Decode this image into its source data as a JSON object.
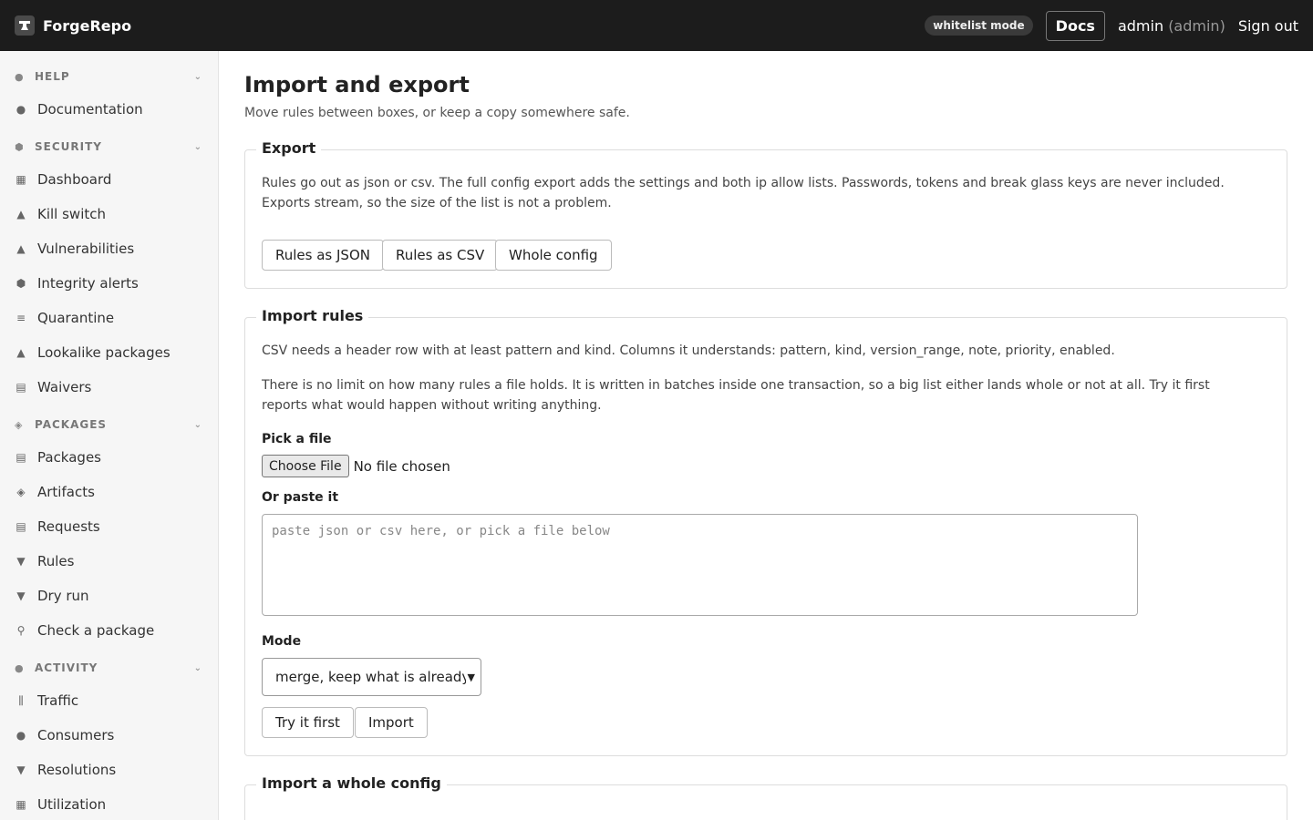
{
  "app": {
    "name": "ForgeRepo"
  },
  "header": {
    "mode_badge": "whitelist mode",
    "docs_label": "Docs",
    "user_name": "admin",
    "user_role": "(admin)",
    "sign_out_label": "Sign out"
  },
  "sidebar": {
    "sections": [
      {
        "label": "HELP",
        "icon": "info-icon"
      },
      {
        "label": "SECURITY",
        "icon": "shield-icon"
      },
      {
        "label": "PACKAGES",
        "icon": "box-icon"
      },
      {
        "label": "ACTIVITY",
        "icon": "info-icon"
      }
    ],
    "items": [
      {
        "label": "Documentation",
        "icon": "info-icon"
      },
      {
        "label": "Dashboard",
        "icon": "grid-icon"
      },
      {
        "label": "Kill switch",
        "icon": "warning-icon"
      },
      {
        "label": "Vulnerabilities",
        "icon": "warning-icon"
      },
      {
        "label": "Integrity alerts",
        "icon": "shield-icon"
      },
      {
        "label": "Quarantine",
        "icon": "list-icon"
      },
      {
        "label": "Lookalike packages",
        "icon": "warning-icon"
      },
      {
        "label": "Waivers",
        "icon": "note-icon"
      },
      {
        "label": "Packages",
        "icon": "archive-icon"
      },
      {
        "label": "Artifacts",
        "icon": "box-icon"
      },
      {
        "label": "Requests",
        "icon": "note-icon"
      },
      {
        "label": "Rules",
        "icon": "filter-icon"
      },
      {
        "label": "Dry run",
        "icon": "filter-icon"
      },
      {
        "label": "Check a package",
        "icon": "search-icon"
      },
      {
        "label": "Traffic",
        "icon": "bars-icon"
      },
      {
        "label": "Consumers",
        "icon": "user-icon"
      },
      {
        "label": "Resolutions",
        "icon": "filter-icon"
      },
      {
        "label": "Utilization",
        "icon": "grid-icon"
      }
    ]
  },
  "main": {
    "title": "Import and export",
    "subtitle": "Move rules between boxes, or keep a copy somewhere safe.",
    "export": {
      "legend": "Export",
      "description": "Rules go out as json or csv. The full config export adds the settings and both ip allow lists. Passwords, tokens and break glass keys are never included. Exports stream, so the size of the list is not a problem.",
      "buttons": [
        "Rules as JSON",
        "Rules as CSV",
        "Whole config"
      ]
    },
    "import_rules": {
      "legend": "Import rules",
      "csv_note": "CSV needs a header row with at least pattern and kind. Columns it understands: pattern, kind, version_range, note, priority, enabled.",
      "limit_note": "There is no limit on how many rules a file holds. It is written in batches inside one transaction, so a big list either lands whole or not at all. Try it first reports what would happen without writing anything.",
      "file_label": "Pick a file",
      "file_button": "Choose File",
      "file_status": "No file chosen",
      "paste_label": "Or paste it",
      "paste_placeholder": "paste json or csv here, or pick a file below",
      "mode_label": "Mode",
      "mode_value": "merge, keep what is already",
      "try_label": "Try it first",
      "import_label": "Import"
    },
    "import_config": {
      "legend": "Import a whole config"
    }
  }
}
